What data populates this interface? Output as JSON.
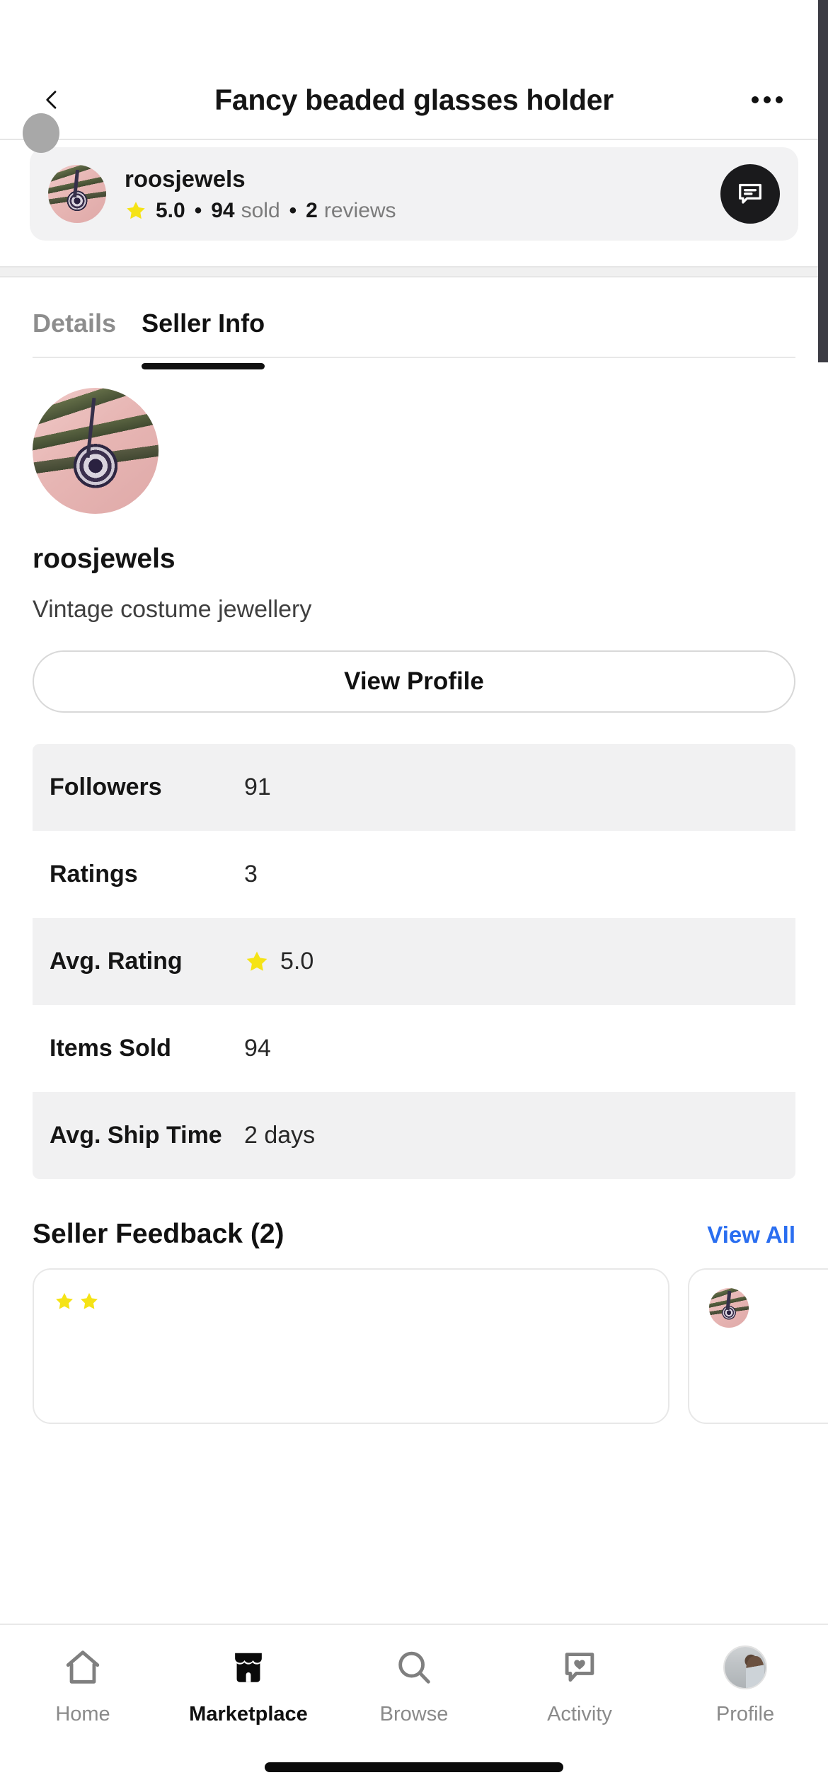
{
  "header": {
    "title": "Fancy beaded glasses holder",
    "back_icon": "chevron-left-icon",
    "more_icon": "overflow-menu-icon"
  },
  "seller_card": {
    "name": "roosjewels",
    "rating": "5.0",
    "sold_count": "94",
    "sold_label": "sold",
    "reviews_count": "2",
    "reviews_label": "reviews",
    "separator": "•",
    "star_icon": "star-icon",
    "message_icon": "message-bubble-icon",
    "avatar_icon": "seller-avatar"
  },
  "tabs": [
    {
      "label": "Details",
      "active": false
    },
    {
      "label": "Seller Info",
      "active": true
    }
  ],
  "profile": {
    "name": "roosjewels",
    "bio": "Vintage costume jewellery",
    "view_profile_label": "View Profile",
    "avatar_icon": "seller-avatar-large"
  },
  "stats": {
    "rows": [
      {
        "label": "Followers",
        "value": "91",
        "shaded": true,
        "has_star": false
      },
      {
        "label": "Ratings",
        "value": "3",
        "shaded": false,
        "has_star": false
      },
      {
        "label": "Avg. Rating",
        "value": "5.0",
        "shaded": true,
        "has_star": true
      },
      {
        "label": "Items Sold",
        "value": "94",
        "shaded": false,
        "has_star": false
      },
      {
        "label": "Avg. Ship Time",
        "value": "2 days",
        "shaded": true,
        "has_star": false
      }
    ]
  },
  "feedback": {
    "title": "Seller Feedback (2)",
    "view_all_label": "View All"
  },
  "bottom_nav": {
    "items": [
      {
        "label": "Home",
        "icon": "home-icon",
        "active": false
      },
      {
        "label": "Marketplace",
        "icon": "storefront-icon",
        "active": true
      },
      {
        "label": "Browse",
        "icon": "search-icon",
        "active": false
      },
      {
        "label": "Activity",
        "icon": "heart-bubble-icon",
        "active": false
      },
      {
        "label": "Profile",
        "icon": "profile-avatar",
        "active": false
      }
    ]
  },
  "colors": {
    "accent_link": "#2a6ef0",
    "star_yellow": "#f5e316",
    "active_dark": "#111111",
    "muted_gray": "#8a8a8a",
    "row_shade": "#f1f1f2",
    "card_bg": "#f2f2f3"
  }
}
